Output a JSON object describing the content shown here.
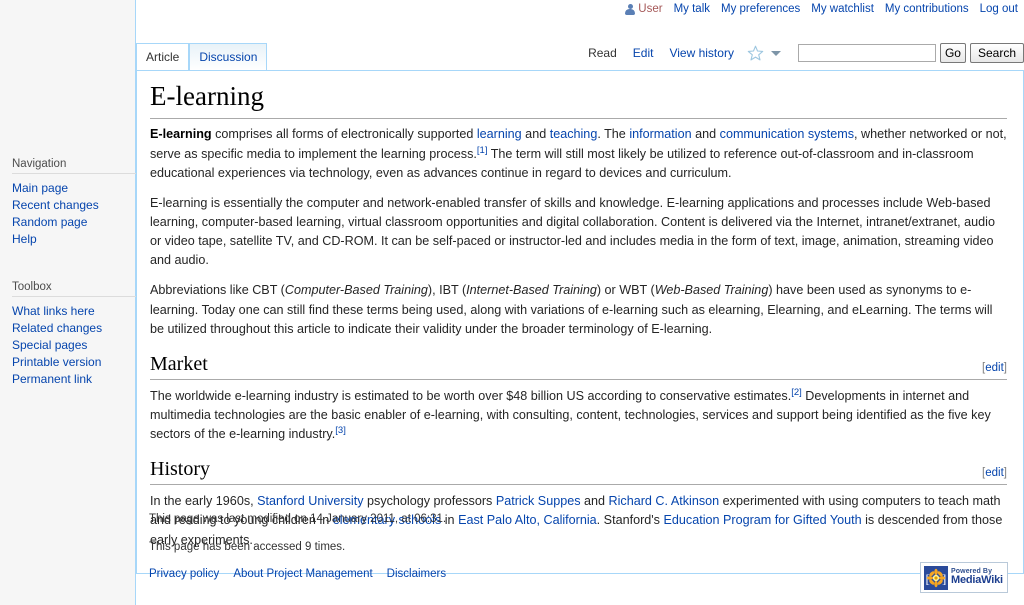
{
  "personal_bar": {
    "user_icon": "user-avatar-icon",
    "username": "User",
    "items": [
      {
        "label": "My talk"
      },
      {
        "label": "My preferences"
      },
      {
        "label": "My watchlist"
      },
      {
        "label": "My contributions"
      }
    ],
    "logout": "Log out"
  },
  "namespace_tabs": [
    {
      "label": "Article",
      "selected": true
    },
    {
      "label": "Discussion",
      "selected": false
    }
  ],
  "view_actions": [
    {
      "label": "Read",
      "selected": true
    },
    {
      "label": "Edit",
      "selected": false
    },
    {
      "label": "View history",
      "selected": false
    }
  ],
  "watch_icon": "star-icon",
  "more_actions_icon": "chevron-down-icon",
  "search": {
    "value": "",
    "placeholder": "",
    "go_label": "Go",
    "search_label": "Search"
  },
  "sidebar": {
    "navigation": {
      "heading": "Navigation",
      "items": [
        {
          "label": "Main page"
        },
        {
          "label": "Recent changes"
        },
        {
          "label": "Random page"
        },
        {
          "label": "Help"
        }
      ]
    },
    "toolbox": {
      "heading": "Toolbox",
      "items": [
        {
          "label": "What links here"
        },
        {
          "label": "Related changes"
        },
        {
          "label": "Special pages"
        },
        {
          "label": "Printable version"
        },
        {
          "label": "Permanent link"
        }
      ]
    }
  },
  "article": {
    "title": "E-learning",
    "lead": {
      "p1_a": "E-learning",
      "p1_b": " comprises all forms of electronically supported ",
      "link_learning": "learning",
      "p1_c": " and ",
      "link_teaching": "teaching",
      "p1_d": ". The ",
      "link_information": "information",
      "p1_e": " and ",
      "link_comm": "communication systems",
      "p1_f": ", whether networked or not, serve as specific media to implement the learning process.",
      "ref1": "[1]",
      "p1_g": " The term will still most likely be utilized to reference out-of-classroom and in-classroom educational experiences via technology, even as advances continue in regard to devices and curriculum."
    },
    "p2": "E-learning is essentially the computer and network-enabled transfer of skills and knowledge. E-learning applications and processes include Web-based learning, computer-based learning, virtual classroom opportunities and digital collaboration. Content is delivered via the Internet, intranet/extranet, audio or video tape, satellite TV, and CD-ROM. It can be self-paced or instructor-led and includes media in the form of text, image, animation, streaming video and audio.",
    "p3": {
      "a": "Abbreviations like CBT (",
      "i1": "Computer-Based Training",
      "b": "), IBT (",
      "i2": "Internet-Based Training",
      "c": ") or WBT (",
      "i3": "Web-Based Training",
      "d": ") have been used as synonyms to e-learning. Today one can still find these terms being used, along with variations of e-learning such as elearning, Elearning, and eLearning. The terms will be utilized throughout this article to indicate their validity under the broader terminology of E-learning."
    },
    "sections": [
      {
        "heading": "Market",
        "edit_label": "edit",
        "edit_bracket_open": "[",
        "edit_bracket_close": "]",
        "body": {
          "a": "The worldwide e-learning industry is estimated to be worth over $48 billion US according to conservative estimates.",
          "ref": "[2]",
          "b": " Developments in internet and multimedia technologies are the basic enabler of e-learning, with consulting, content, technologies, services and support being identified as the five key sectors of the e-learning industry.",
          "ref2": "[3]"
        }
      },
      {
        "heading": "History",
        "edit_label": "edit",
        "edit_bracket_open": "[",
        "edit_bracket_close": "]",
        "body": {
          "a": "In the early 1960s, ",
          "link1": "Stanford University",
          "b": " psychology professors ",
          "link2": "Patrick Suppes",
          "c": " and ",
          "link3": "Richard C. Atkinson",
          "d": " experimented with using computers to teach math and reading to young children in ",
          "link4": "elementary schools",
          "e": " in ",
          "link5": "East Palo Alto, California",
          "f": ". Stanford's ",
          "link6": "Education Program for Gifted Youth",
          "g": " is descended from those early experiments."
        }
      }
    ]
  },
  "footer": {
    "last_modified": "This page was last modified on 14 January 2011, at 06:31.",
    "view_count": "This page has been accessed 9 times.",
    "places": [
      {
        "label": "Privacy policy"
      },
      {
        "label": "About Project Management"
      },
      {
        "label": "Disclaimers"
      }
    ],
    "badge": {
      "line1": "Powered By",
      "line2": "MediaWiki",
      "icon": "mediawiki-sunflower-icon"
    }
  },
  "colors": {
    "link": "#0645ad",
    "border_blue": "#a7d7f9",
    "sidebar_bg": "#f6f6f6"
  }
}
